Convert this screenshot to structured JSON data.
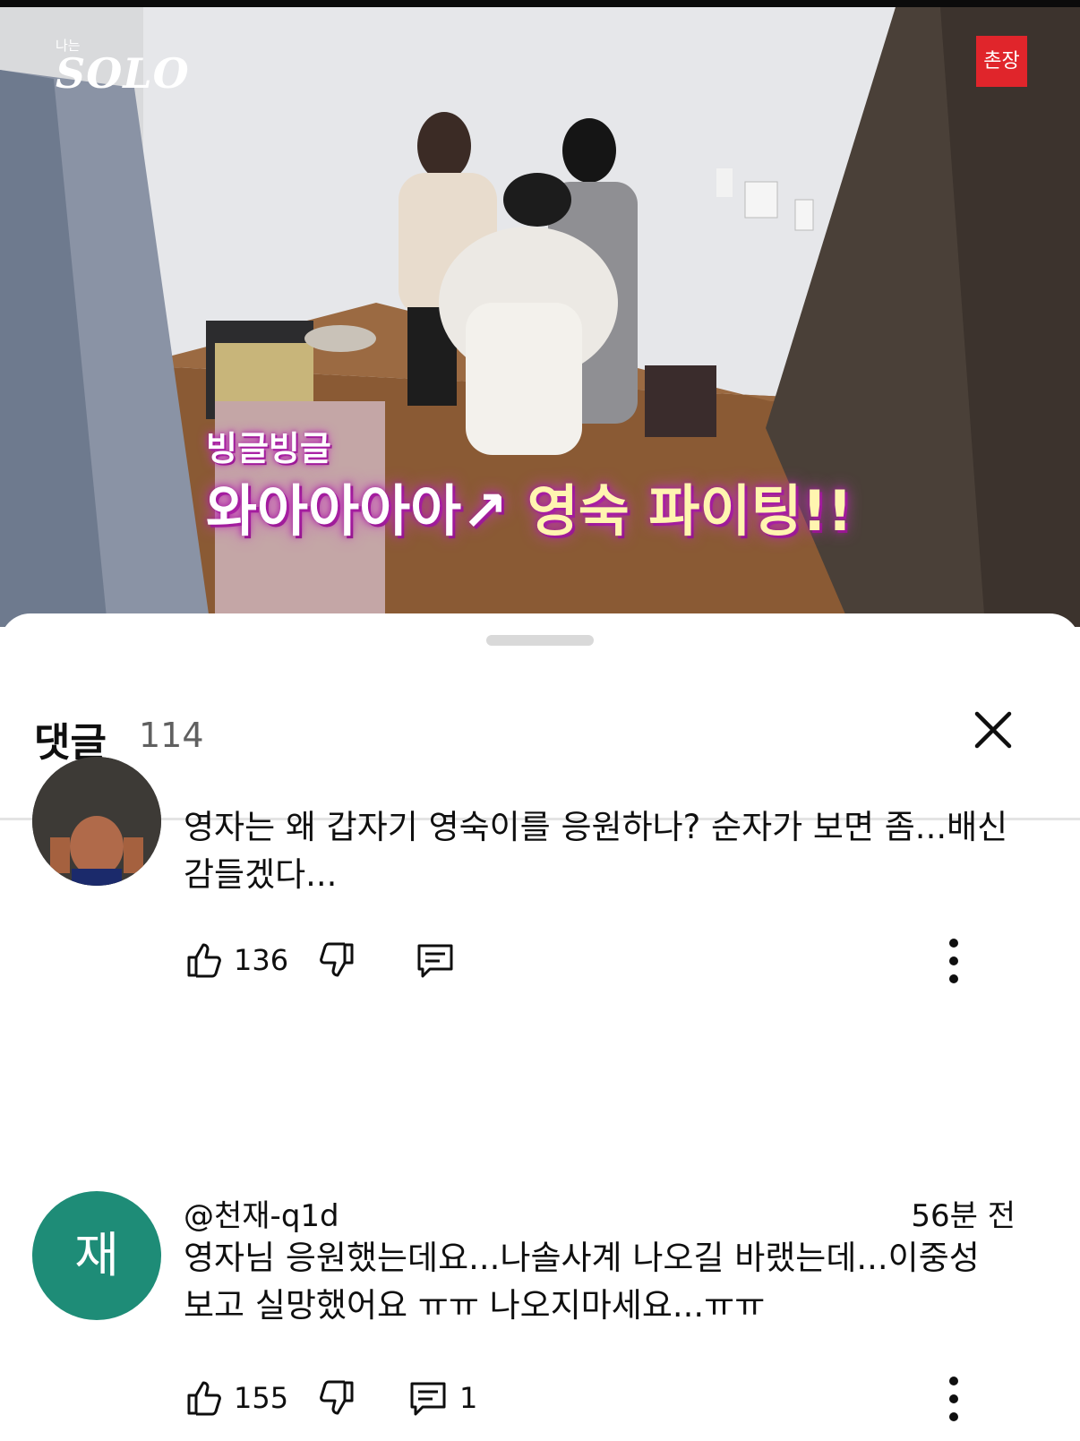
{
  "video": {
    "show_logo_small": "나는",
    "show_logo_big": "SOLO",
    "channel_badge": "촌장",
    "caption_top": "빙글빙글",
    "caption_main_white": "와아아아아↗",
    "caption_main_yellow": "영숙 파이팅!!"
  },
  "comments_panel": {
    "title": "댓글",
    "count": "114",
    "close_icon": "close-icon"
  },
  "comments": [
    {
      "avatar": "photo-avatar",
      "text": "영자는 왜 갑자기 영숙이를 응원하나? 순자가 보면 좀...배신감들겠다...",
      "likes": "136",
      "replies": ""
    },
    {
      "avatar_letter": "재",
      "author": "@천재-q1d",
      "time": "56분 전",
      "text": "영자님 응원했는데요...나솔사계 나오길 바랬는데...이중성 보고 실망했어요 ㅠㅠ 나오지마세요...ㅠㅠ",
      "likes": "155",
      "replies": "1"
    }
  ],
  "colors": {
    "accent_green_avatar": "#1e8c77",
    "caption_glow": "#d13ec7"
  }
}
